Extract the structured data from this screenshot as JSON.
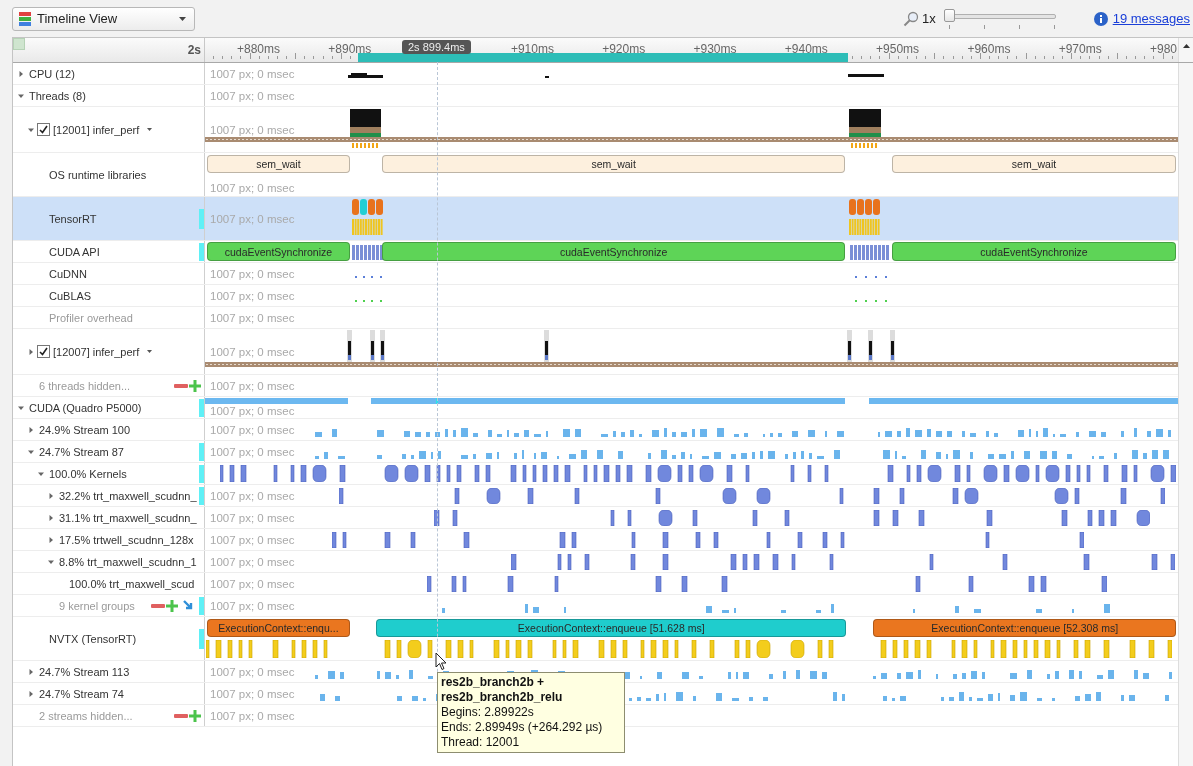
{
  "toolbar": {
    "view": "Timeline View",
    "zoom": "1x",
    "zoom_slider": {
      "level": 0
    },
    "messages": "19 messages"
  },
  "ruler": {
    "origin": "2s",
    "ticks": [
      "+880ms",
      "+890ms",
      "+910ms",
      "+920ms",
      "+930ms",
      "+940ms",
      "+950ms",
      "+960ms",
      "+970ms",
      "+980"
    ],
    "cursor": "2s 899.4ms"
  },
  "rows": [
    {
      "label": "CPU (12)",
      "kind": "cpu",
      "expanded": false,
      "selected": false,
      "marked": false,
      "note": "1007 px; 0 msec"
    },
    {
      "label": "Threads (8)",
      "kind": "plain",
      "expanded": true,
      "selected": false,
      "marked": false,
      "note": "1007 px; 0 msec",
      "children": [
        {
          "label": "[12001] infer_perf",
          "kind": "thread-busy",
          "expanded": true,
          "checked": true,
          "selected": false,
          "marked": false,
          "note": "1007 px; 0 msec",
          "children": [
            {
              "label": "OS runtime libraries",
              "kind": "wait-ranges",
              "selected": false,
              "marked": false,
              "note": "1007 px; 0 msec",
              "segments": [
                {
                  "label": "sem_wait",
                  "color": "#fdf0de"
                },
                {
                  "label": "sem_wait",
                  "color": "#fdf0de"
                },
                {
                  "label": "sem_wait",
                  "color": "#fdf0de"
                }
              ]
            },
            {
              "label": "TensorRT",
              "kind": "trt",
              "selected": true,
              "marked": true,
              "note": "1007 px; 0 msec"
            },
            {
              "label": "CUDA API",
              "kind": "api",
              "selected": false,
              "marked": true,
              "segments": [
                {
                  "label": "cudaEventSynchronize",
                  "color": "#5ed457"
                },
                {
                  "label": "cudaEventSynchronize",
                  "color": "#5ed457"
                },
                {
                  "label": "cudaEventSynchronize",
                  "color": "#5ed457"
                }
              ]
            },
            {
              "label": "CuDNN",
              "kind": "dots-blue",
              "selected": false,
              "marked": false,
              "note": "1007 px; 0 msec"
            },
            {
              "label": "CuBLAS",
              "kind": "dots-green",
              "selected": false,
              "marked": false,
              "note": "1007 px; 0 msec"
            },
            {
              "label": "Profiler overhead",
              "kind": "overhead",
              "selected": false,
              "marked": false,
              "note": "1007 px; 0 msec"
            }
          ]
        },
        {
          "label": "[12007] infer_perf",
          "kind": "thread-spikes",
          "expanded": false,
          "checked": true,
          "selected": false,
          "marked": false,
          "note": "1007 px; 0 msec"
        },
        {
          "label": "6 threads hidden...",
          "kind": "hidden",
          "selected": false,
          "marked": false,
          "note": "1007 px; 0 msec"
        }
      ]
    },
    {
      "label": "CUDA (Quadro P5000)",
      "kind": "gpu",
      "expanded": true,
      "selected": false,
      "marked": true,
      "note": "1007 px; 0 msec",
      "children": [
        {
          "label": "24.9% Stream 100",
          "kind": "stream",
          "expanded": false,
          "selected": false,
          "marked": false,
          "note": "1007 px; 0 msec"
        },
        {
          "label": "24.7% Stream 87",
          "kind": "stream",
          "expanded": true,
          "selected": false,
          "marked": true,
          "note": "1007 px; 0 msec",
          "children": [
            {
              "label": "100.0% Kernels",
              "kind": "kernels",
              "expanded": true,
              "selected": false,
              "marked": true,
              "children": [
                {
                  "label": "32.2% trt_maxwell_scudnn_",
                  "kind": "kernels-a",
                  "expanded": false,
                  "selected": false,
                  "marked": true,
                  "note": "1007 px; 0 msec"
                },
                {
                  "label": "31.1% trt_maxwell_scudnn_",
                  "kind": "kernels-b",
                  "expanded": false,
                  "selected": false,
                  "marked": false,
                  "note": "1007 px; 0 msec"
                },
                {
                  "label": "17.5% trtwell_scudnn_128x",
                  "kind": "kernels-c",
                  "expanded": false,
                  "selected": false,
                  "marked": false,
                  "note": "1007 px; 0 msec"
                },
                {
                  "label": "8.8% trt_maxwell_scudnn_1",
                  "kind": "kernels-d",
                  "expanded": true,
                  "selected": false,
                  "marked": false,
                  "note": "1007 px; 0 msec",
                  "children": [
                    {
                      "label": "100.0% trt_maxwell_scud",
                      "kind": "kernels-e",
                      "selected": false,
                      "marked": false,
                      "note": "1007 px; 0 msec"
                    }
                  ]
                },
                {
                  "label": "9 kernel groups",
                  "kind": "hidden-groups",
                  "selected": false,
                  "marked": true,
                  "note": "1007 px; 0 msec"
                }
              ]
            },
            {
              "label": "NVTX (TensorRT)",
              "kind": "nvtx",
              "selected": false,
              "marked": true,
              "segments": [
                {
                  "label": "ExecutionContext::enqu...",
                  "color": "#ea761f"
                },
                {
                  "label": "ExecutionContext::enqueue [51.628 ms]",
                  "color": "#1fcdcd"
                },
                {
                  "label": "ExecutionContext::enqueue [52.308 ms]",
                  "color": "#ea761f"
                }
              ]
            }
          ]
        },
        {
          "label": "24.7% Stream 113",
          "kind": "stream",
          "expanded": false,
          "selected": false,
          "marked": false,
          "note": "1007 px; 0 msec"
        },
        {
          "label": "24.7% Stream 74",
          "kind": "stream",
          "expanded": false,
          "selected": false,
          "marked": false,
          "note": "1007 px; 0 msec"
        },
        {
          "label": "2 streams hidden...",
          "kind": "hidden",
          "selected": false,
          "marked": false,
          "note": "1007 px; 0 msec"
        }
      ]
    }
  ],
  "tooltip": {
    "title": "res2b_branch2b + res2b_branch2b_relu",
    "lines": [
      "Begins: 2.89922s",
      "Ends: 2.89949s (+264.292 µs)",
      "Thread: 12001"
    ]
  }
}
